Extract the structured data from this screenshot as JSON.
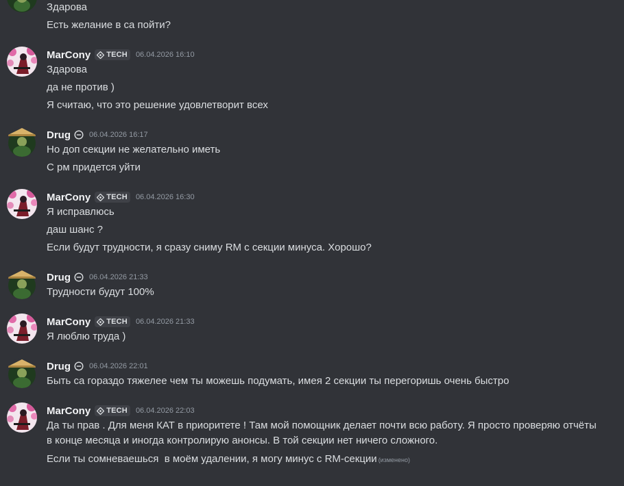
{
  "messages": {
    "top_continuation": [
      "Здарова",
      "Есть желание в са пойти?"
    ],
    "groups": [
      {
        "author": "MarCony",
        "tag": "TECH",
        "timestamp": "06.04.2026 16:10",
        "lines": [
          "Здарова",
          "да не против )",
          "Я считаю, что это решение удовлетворит всех"
        ]
      },
      {
        "author": "Drug",
        "timestamp": "06.04.2026 16:17",
        "lines": [
          "Но доп секции не желательно иметь",
          "С рм придется уйти"
        ]
      },
      {
        "author": "MarCony",
        "tag": "TECH",
        "timestamp": "06.04.2026 16:30",
        "lines": [
          "Я исправлюсь",
          "даш шанс ?",
          "Если будут трудности, я сразу сниму RM с секции минуса. Хорошо?"
        ]
      },
      {
        "author": "Drug",
        "timestamp": "06.04.2026 21:33",
        "lines": [
          "Трудности будут 100%"
        ]
      },
      {
        "author": "MarCony",
        "tag": "TECH",
        "timestamp": "06.04.2026 21:33",
        "lines": [
          "Я люблю труда )"
        ]
      },
      {
        "author": "Drug",
        "timestamp": "06.04.2026 22:01",
        "lines": [
          "Быть са гораздо тяжелее чем ты можешь подумать, имея 2 секции ты перегоришь очень быстро"
        ]
      },
      {
        "author": "MarCony",
        "tag": "TECH",
        "timestamp": "06.04.2026 22:03",
        "lines": [
          "Да ты прав . Для меня КАТ в приоритете ! Там мой помощник делает почти всю работу. Я просто проверяю отчёты в конце месяца и иногда контролирую анонсы. В той секции нет ничего сложного.",
          "Если ты сомневаешься  в моём удалении, я могу минус с RM-секции"
        ],
        "edited_label": "(изменено)"
      }
    ]
  },
  "icons": {
    "tag_icon": "tech-diamond-icon",
    "status_icon": "minus-circle-icon"
  },
  "colors": {
    "background": "#313338",
    "username": "#f2f3f5",
    "text": "#dbdee1",
    "timestamp": "#949ba4",
    "tag_bg": "#3f4147"
  }
}
